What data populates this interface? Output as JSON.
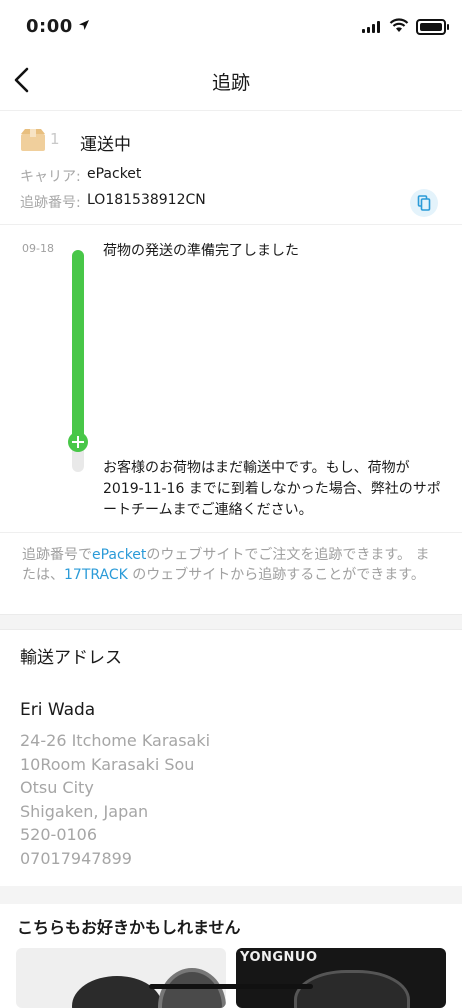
{
  "status_bar": {
    "time": "0:00"
  },
  "nav": {
    "title": "追跡"
  },
  "package": {
    "number": "1",
    "status": "運送中",
    "carrier_label": "キャリア:",
    "carrier": "ePacket",
    "tracking_label": "追跡番号:",
    "tracking_number": "LO181538912CN"
  },
  "timeline": {
    "date": "09-18",
    "event": "荷物の発送の準備完了しました",
    "note": "お客様のお荷物はまだ輸送中です。もし、荷物が2019-11-16 までに到着しなかった場合、弊社のサポートチームまでご連絡ください。"
  },
  "info": {
    "part1": "追跡番号で",
    "link1": "ePacket",
    "part2": "のウェブサイトでご注文を追跡できます。 または、",
    "link2": "17TRACK",
    "part3": " のウェブサイトから追跡することができます。"
  },
  "address": {
    "title": "輸送アドレス",
    "name": "Eri Wada",
    "line1": "24-26 Itchome Karasaki",
    "line2": "10Room Karasaki Sou",
    "line3": "Otsu City",
    "line4": "Shigaken, Japan",
    "zip": "520-0106",
    "phone": "07017947899"
  },
  "recommend": {
    "title": "こちらもお好きかもしれません",
    "product2_brand": "YONGNUO"
  },
  "colors": {
    "accent": "#2b9bd8",
    "progress": "#48c748"
  }
}
